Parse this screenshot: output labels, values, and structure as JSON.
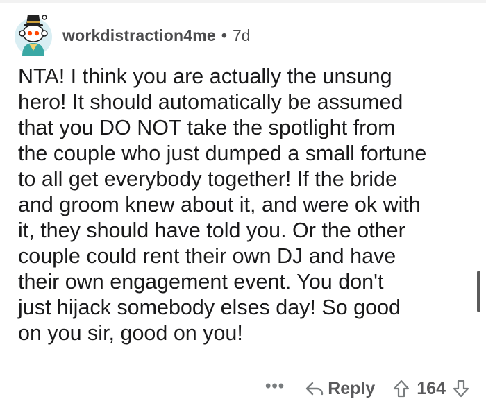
{
  "comment": {
    "author": "workdistraction4me",
    "separator": "•",
    "age": "7d",
    "body": "NTA! I think you are actually the unsung\nhero! It should automatically be assumed\nthat you DO NOT take the spotlight from\nthe couple who just dumped a small fortune\nto all get everybody together! If the bride\nand groom knew about it, and were ok with\nit, they should have told you.  Or the other\ncouple could rent their own DJ and have\ntheir own engagement event.  You don't\njust hijack somebody elses day!  So good\non you sir, good on you!",
    "more_label": "•••",
    "reply_label": "Reply",
    "score": "164"
  },
  "icons": {
    "avatar": "snoo-avatar-icon",
    "reply": "reply-arrow-icon",
    "upvote": "upvote-arrow-icon",
    "downvote": "downvote-arrow-icon"
  },
  "colors": {
    "text": "#1a1a1b",
    "meta": "#4b4b4d",
    "action": "#787c7e",
    "avatar_bg": "#d9eef3",
    "hat": "#222222"
  }
}
